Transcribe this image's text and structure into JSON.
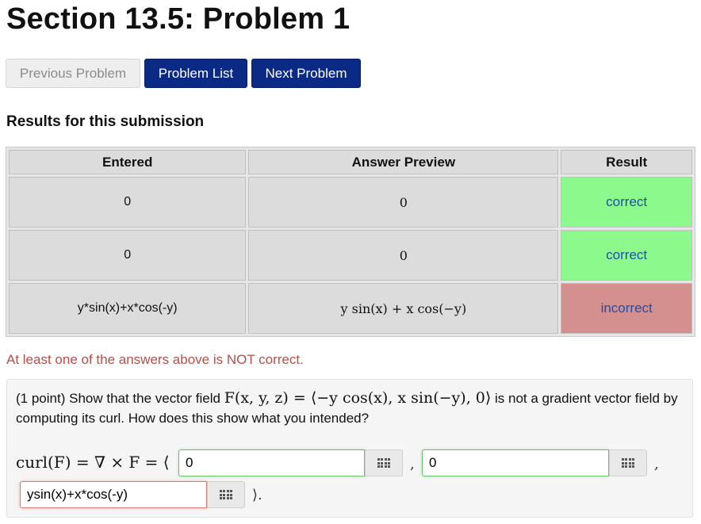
{
  "page": {
    "title": "Section 13.5: Problem 1"
  },
  "nav": {
    "previous_label": "Previous Problem",
    "list_label": "Problem List",
    "next_label": "Next Problem"
  },
  "results": {
    "heading": "Results for this submission",
    "columns": [
      "Entered",
      "Answer Preview",
      "Result"
    ],
    "rows": [
      {
        "entered": "0",
        "preview": "0",
        "result": "correct",
        "status_color": "#8cf98c"
      },
      {
        "entered": "0",
        "preview": "0",
        "result": "correct",
        "status_color": "#8cf98c"
      },
      {
        "entered": "y*sin(x)+x*cos(-y)",
        "preview": "y sin(x) + x cos(−y)",
        "result": "incorrect",
        "status_color": "#d48f8f"
      }
    ],
    "warning": "At least one of the answers above is NOT correct."
  },
  "problem": {
    "points": "(1 point)",
    "text_before": "Show that the vector field",
    "field_expression": "F(x, y, z) = ⟨−y cos(x), x sin(−y), 0⟩",
    "text_after": "is not a gradient vector field by computing its curl. How does this show what you intended?",
    "curl_label": "curl(F) = ∇ × F = ⟨",
    "answers": [
      {
        "value": "0",
        "state": "correct"
      },
      {
        "value": "0",
        "state": "correct"
      },
      {
        "value": "ysin(x)+x*cos(-y)",
        "state": "incorrect"
      }
    ],
    "separator": ",",
    "closing": "⟩.",
    "equation_editor_icon": "grid-icon"
  },
  "colors": {
    "primary_button": "#0b2a86",
    "correct": "#8cf98c",
    "incorrect": "#d48f8f",
    "warning_text": "#b54f48",
    "result_text": "#1f4faa"
  }
}
